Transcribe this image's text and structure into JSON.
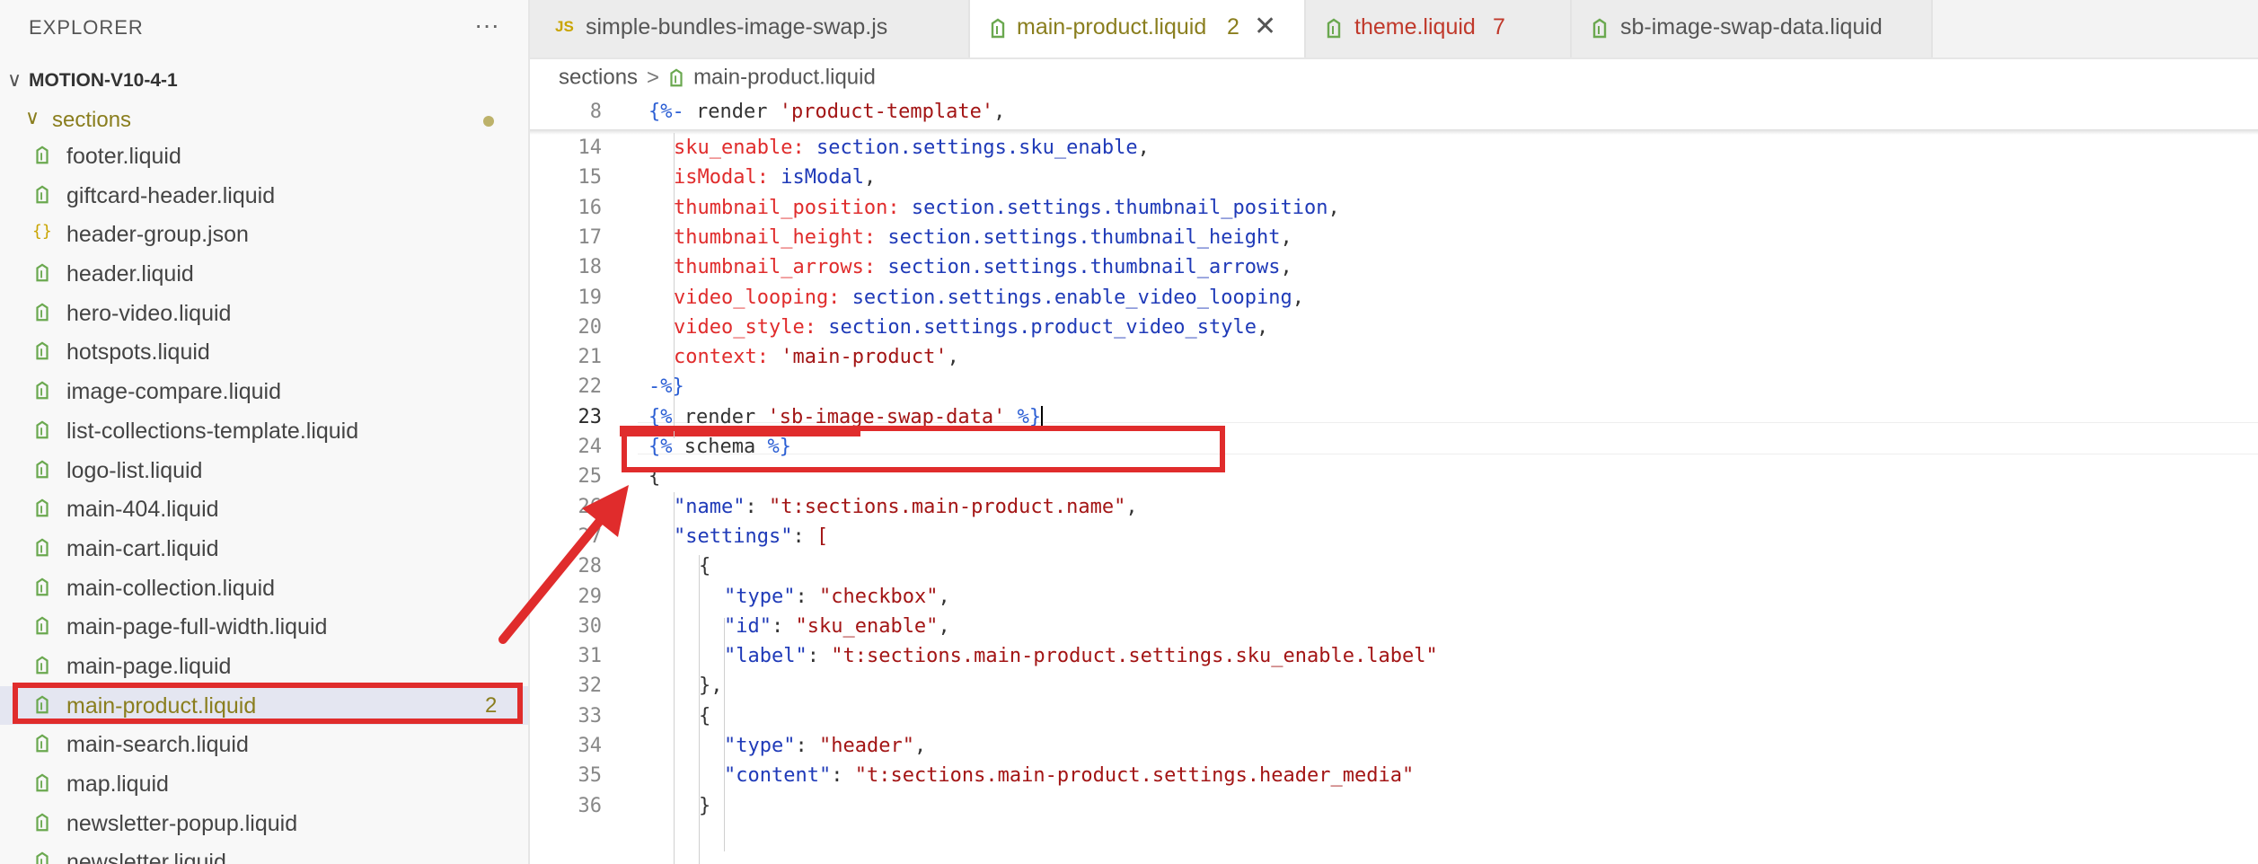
{
  "sidebar": {
    "title": "EXPLORER",
    "more_icon": "ellipsis-icon",
    "project": "MOTION-V10-4-1",
    "folder": "sections",
    "files": [
      {
        "name": "footer.liquid",
        "type": "liquid"
      },
      {
        "name": "giftcard-header.liquid",
        "type": "liquid"
      },
      {
        "name": "header-group.json",
        "type": "json"
      },
      {
        "name": "header.liquid",
        "type": "liquid"
      },
      {
        "name": "hero-video.liquid",
        "type": "liquid"
      },
      {
        "name": "hotspots.liquid",
        "type": "liquid"
      },
      {
        "name": "image-compare.liquid",
        "type": "liquid"
      },
      {
        "name": "list-collections-template.liquid",
        "type": "liquid"
      },
      {
        "name": "logo-list.liquid",
        "type": "liquid"
      },
      {
        "name": "main-404.liquid",
        "type": "liquid"
      },
      {
        "name": "main-cart.liquid",
        "type": "liquid"
      },
      {
        "name": "main-collection.liquid",
        "type": "liquid"
      },
      {
        "name": "main-page-full-width.liquid",
        "type": "liquid"
      },
      {
        "name": "main-page.liquid",
        "type": "liquid"
      },
      {
        "name": "main-product.liquid",
        "type": "liquid",
        "selected": true,
        "badge": "2"
      },
      {
        "name": "main-search.liquid",
        "type": "liquid"
      },
      {
        "name": "map.liquid",
        "type": "liquid"
      },
      {
        "name": "newsletter-popup.liquid",
        "type": "liquid"
      },
      {
        "name": "newsletter.liquid",
        "type": "liquid"
      }
    ]
  },
  "tabs": [
    {
      "icon_text": "JS",
      "label": "simple-bundles-image-swap.js",
      "badge": "",
      "active": false
    },
    {
      "icon_text": "",
      "label": "main-product.liquid",
      "badge": "2",
      "active": true,
      "close": "✕"
    },
    {
      "icon_text": "",
      "label": "theme.liquid",
      "badge": "7",
      "active": false
    },
    {
      "icon_text": "",
      "label": "sb-image-swap-data.liquid",
      "badge": "",
      "active": false
    }
  ],
  "breadcrumb": {
    "folder": "sections",
    "separator": ">",
    "file": "main-product.liquid"
  },
  "editor": {
    "sticky": {
      "num": "8",
      "code": "{%- render 'product-template',"
    },
    "lines": [
      {
        "num": "14",
        "code": "sku_enable: section.settings.sku_enable,"
      },
      {
        "num": "15",
        "code": "isModal: isModal,"
      },
      {
        "num": "16",
        "code": "thumbnail_position: section.settings.thumbnail_position,"
      },
      {
        "num": "17",
        "code": "thumbnail_height: section.settings.thumbnail_height,"
      },
      {
        "num": "18",
        "code": "thumbnail_arrows: section.settings.thumbnail_arrows,"
      },
      {
        "num": "19",
        "code": "video_looping: section.settings.enable_video_looping,"
      },
      {
        "num": "20",
        "code": "video_style: section.settings.product_video_style,"
      },
      {
        "num": "21",
        "code": "context: 'main-product',"
      },
      {
        "num": "22",
        "code": "-%}"
      },
      {
        "num": "23",
        "code": "{% render 'sb-image-swap-data' %}"
      },
      {
        "num": "24",
        "code": "{% schema %}"
      },
      {
        "num": "25",
        "code": "{"
      },
      {
        "num": "26",
        "code": "\"name\": \"t:sections.main-product.name\","
      },
      {
        "num": "27",
        "code": "\"settings\": ["
      },
      {
        "num": "28",
        "code": "{"
      },
      {
        "num": "29",
        "code": "\"type\": \"checkbox\","
      },
      {
        "num": "30",
        "code": "\"id\": \"sku_enable\","
      },
      {
        "num": "31",
        "code": "\"label\": \"t:sections.main-product.settings.sku_enable.label\""
      },
      {
        "num": "32",
        "code": "},"
      },
      {
        "num": "33",
        "code": "{"
      },
      {
        "num": "34",
        "code": "\"type\": \"header\","
      },
      {
        "num": "35",
        "code": "\"content\": \"t:sections.main-product.settings.header_media\""
      },
      {
        "num": "36",
        "code": "}"
      }
    ]
  },
  "colors": {
    "highlight": "#e02c2c",
    "liquid_icon": "#6aa84f",
    "modified": "#8a7e1e"
  }
}
